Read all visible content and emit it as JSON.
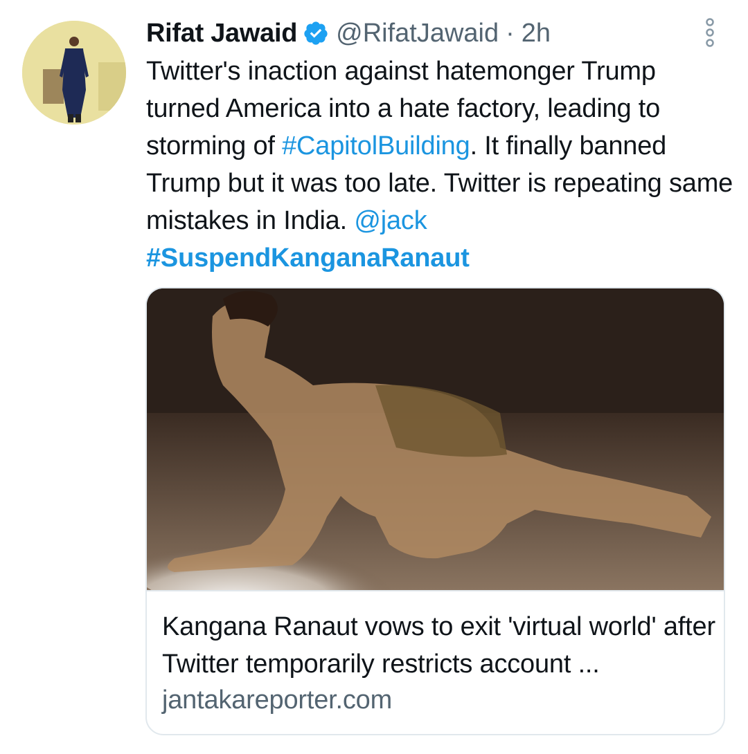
{
  "author": {
    "name": "Rifat Jawaid",
    "handle": "@RifatJawaid",
    "separator": "·",
    "time": "2h",
    "verified": true
  },
  "tweet": {
    "segments": [
      {
        "text": "Twitter's inaction against hatemonger Trump turned America into a hate factory, leading to storming of ",
        "type": "text"
      },
      {
        "text": "#CapitolBuilding",
        "type": "hashtag"
      },
      {
        "text": ". It finally banned Trump but it was too late. Twitter is repeating same mistakes in India. ",
        "type": "text"
      },
      {
        "text": "@jack",
        "type": "mention"
      },
      {
        "text": "#SuspendKanganaRanaut",
        "type": "hashtag-bold"
      }
    ]
  },
  "card": {
    "title": "Kangana Ranaut vows to exit 'virtual world' after Twitter temporarily restricts account ...",
    "domain": "jantakareporter.com"
  },
  "colors": {
    "link": "#1b95e0",
    "verified_badge": "#1da1f2",
    "secondary_text": "#536471",
    "border": "#e1e8ed"
  },
  "icons": {
    "verified": "verified-badge-icon",
    "more": "more-options-icon"
  }
}
